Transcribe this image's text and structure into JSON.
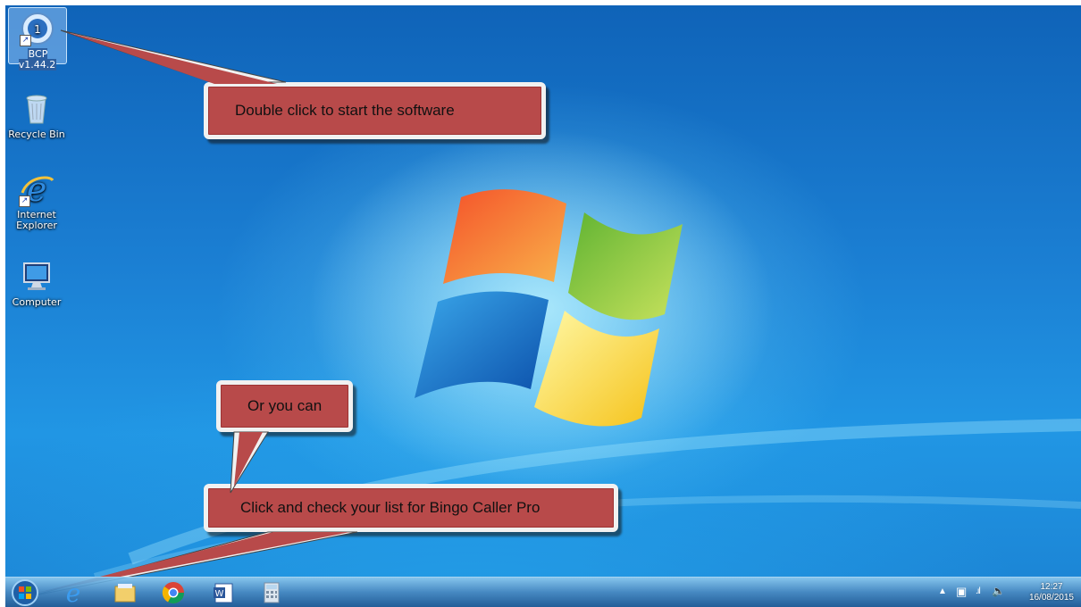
{
  "desktop_icons": [
    {
      "label": "BCP v1.44.2",
      "icon": "bingo-caller-pro-icon",
      "selected": true
    },
    {
      "label": "Recycle Bin",
      "icon": "recycle-bin-icon"
    },
    {
      "label": "Internet Explorer",
      "icon": "internet-explorer-icon"
    },
    {
      "label": "Computer",
      "icon": "computer-icon"
    }
  ],
  "callouts": {
    "double_click": "Double click to start the software",
    "or_you_can": "Or you can",
    "click_check": "Click and check your list for Bingo Caller Pro"
  },
  "taskbar": {
    "pinned": [
      "start-orb-icon",
      "internet-explorer-icon",
      "file-explorer-icon",
      "chrome-icon",
      "word-icon",
      "calculator-icon"
    ],
    "tray": {
      "time": "12:27",
      "date": "16/08/2015"
    }
  },
  "colors": {
    "callout": "#b84a4a",
    "callout_border": "#f1f1f1",
    "desktop_blue": "#1b7fd3"
  }
}
